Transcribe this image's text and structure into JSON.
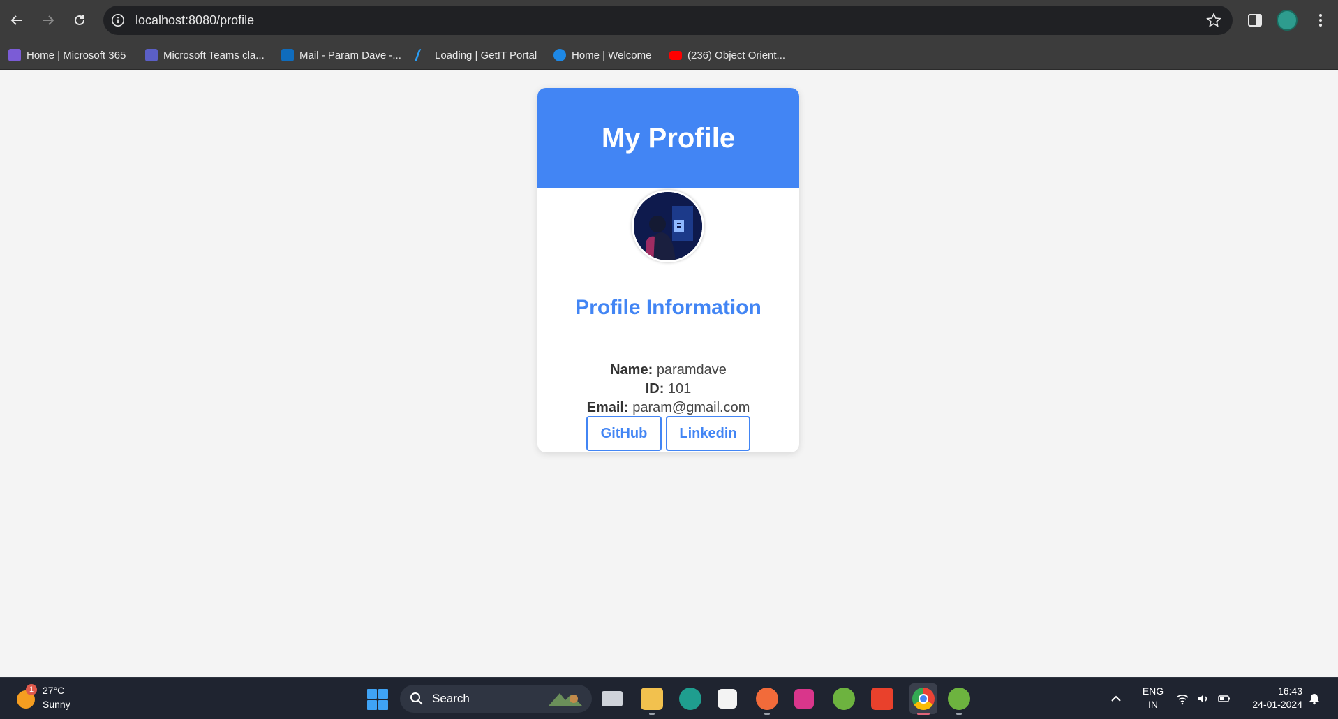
{
  "browser": {
    "url": "localhost:8080/profile",
    "bookmarks": [
      {
        "label": "Home | Microsoft 365",
        "icon": "microsoft365-icon",
        "color": "#7b5cd6"
      },
      {
        "label": "Microsoft Teams cla...",
        "icon": "teams-icon",
        "color": "#5b5fc7"
      },
      {
        "label": "Mail - Param Dave -...",
        "icon": "outlook-icon",
        "color": "#0f6cbd"
      },
      {
        "label": "Loading | GetIT Portal",
        "icon": "getit-icon",
        "color": "#2a9df4"
      },
      {
        "label": "Home | Welcome",
        "icon": "k-icon",
        "color": "#1e88e5"
      },
      {
        "label": "(236) Object Orient...",
        "icon": "youtube-icon",
        "color": "#ff0000"
      }
    ]
  },
  "profile": {
    "header_title": "My Profile",
    "section_title": "Profile Information",
    "name_label": "Name:",
    "name_value": "paramdave",
    "id_label": "ID:",
    "id_value": "101",
    "email_label": "Email:",
    "email_value": "param@gmail.com",
    "github_label": "GitHub",
    "linkedin_label": "Linkedin",
    "accent_color": "#4285f4"
  },
  "taskbar": {
    "weather_temp": "27°C",
    "weather_desc": "Sunny",
    "weather_badge": "1",
    "search_label": "Search",
    "lang_line1": "ENG",
    "lang_line2": "IN",
    "time": "16:43",
    "date": "24-01-2024"
  }
}
